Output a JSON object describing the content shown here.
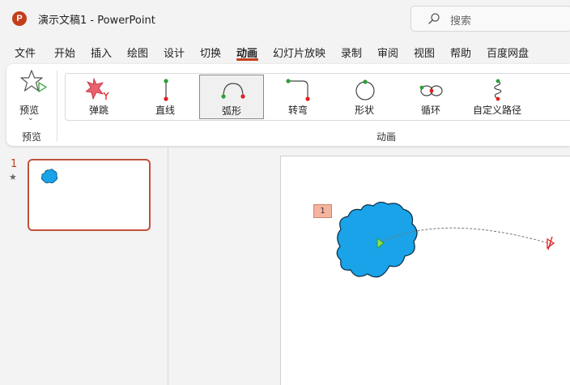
{
  "app": {
    "logo_letter": "P",
    "title": "演示文稿1  -  PowerPoint"
  },
  "search": {
    "placeholder": "搜索",
    "icon": "search-icon"
  },
  "menu": {
    "items": [
      "文件",
      "开始",
      "插入",
      "绘图",
      "设计",
      "切换",
      "动画",
      "幻灯片放映",
      "录制",
      "审阅",
      "视图",
      "帮助",
      "百度网盘"
    ],
    "active": "动画"
  },
  "ribbon": {
    "preview": {
      "label": "预览",
      "caret": "⌄",
      "group_name": "预览",
      "icon": "star-preview-icon"
    },
    "animation_gallery": {
      "items": [
        {
          "label": "弹跳",
          "icon": "bounce-icon",
          "selected": false
        },
        {
          "label": "直线",
          "icon": "line-path-icon",
          "selected": false
        },
        {
          "label": "弧形",
          "icon": "arc-path-icon",
          "selected": true
        },
        {
          "label": "转弯",
          "icon": "turn-path-icon",
          "selected": false
        },
        {
          "label": "形状",
          "icon": "shape-path-icon",
          "selected": false
        },
        {
          "label": "循环",
          "icon": "loop-path-icon",
          "selected": false
        },
        {
          "label": "自定义路径",
          "icon": "custom-path-icon",
          "selected": false
        }
      ],
      "group_name": "动画"
    }
  },
  "slides_pane": {
    "slide_number": "1",
    "animation_marker": "★"
  },
  "slide": {
    "animation_tag": "1",
    "shape": "cloud",
    "shape_color": "#1aa3e8",
    "path_type": "arc"
  },
  "colors": {
    "accent": "#c43e1c",
    "path_start": "#2e9e3a",
    "path_end": "#e0201c"
  }
}
